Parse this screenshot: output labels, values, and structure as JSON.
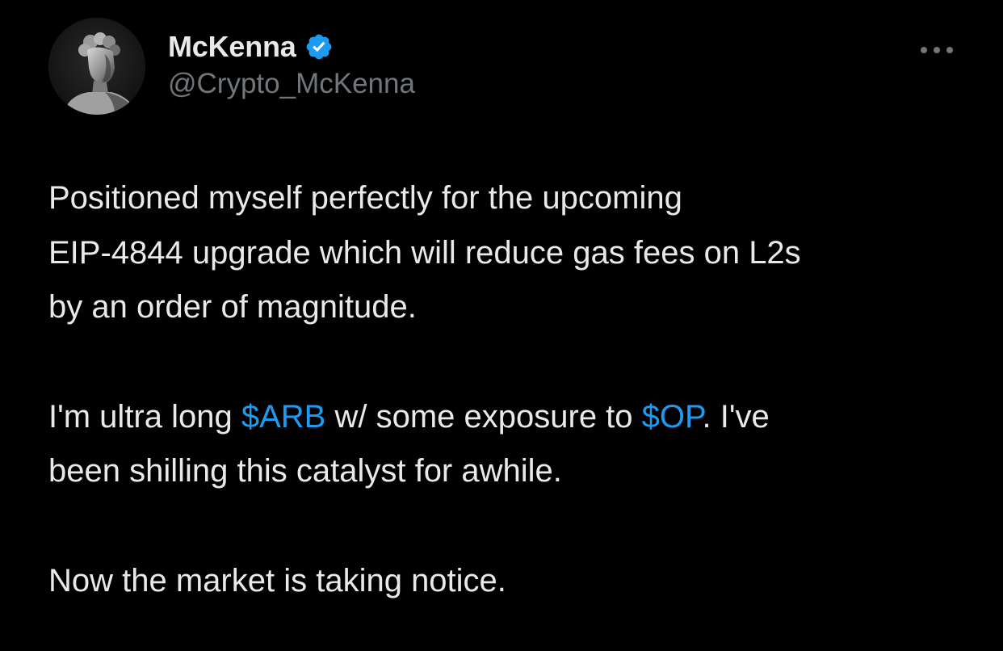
{
  "tweet": {
    "author": {
      "display_name": "McKenna",
      "handle": "@Crypto_McKenna",
      "verified": true,
      "avatar_icon": "statue-avatar-icon",
      "verified_icon": "verified-badge-icon",
      "verified_color": "#1d9bf0"
    },
    "more_icon": "more-options-icon",
    "paragraphs": {
      "p1_line1": "Positioned myself perfectly for the upcoming",
      "p1_line2": "EIP-4844 upgrade which will reduce gas fees on L2s",
      "p1_line3": "by an order of magnitude.",
      "p2_pre": "I'm ultra long ",
      "p2_cashtag1": "$ARB",
      "p2_mid": " w/ some exposure to ",
      "p2_cashtag2": "$OP",
      "p2_post": ". I've",
      "p2_line2": "been shilling this catalyst for awhile.",
      "p3_line1": "Now the market is taking notice."
    }
  },
  "colors": {
    "background": "#000000",
    "text_primary": "#e7e9ea",
    "text_secondary": "#71767b",
    "link": "#1d9bf0"
  }
}
